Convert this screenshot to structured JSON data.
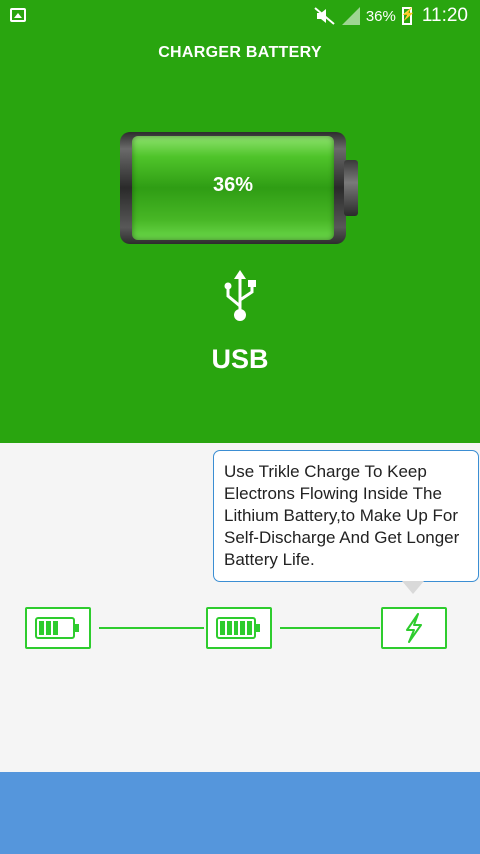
{
  "status_bar": {
    "battery_percent": "36%",
    "time": "11:20",
    "icons": [
      "gallery-notification-icon",
      "mute-icon",
      "signal-icon",
      "battery-charging-icon"
    ]
  },
  "header": {
    "title": "CHARGER BATTERY"
  },
  "battery": {
    "percent_text": "36%",
    "level": 0.36
  },
  "source": {
    "label": "USB",
    "icon": "usb-icon"
  },
  "tip": {
    "text": "Use Trikle Charge To Keep Electrons Flowing Inside The Lithium Battery,to Make Up For Self-Discharge And Get Longer Battery Life."
  },
  "stages": [
    {
      "name": "fast-charge",
      "icon": "battery-partial-icon",
      "cells": 3
    },
    {
      "name": "full-charge",
      "icon": "battery-full-icon",
      "cells": 5
    },
    {
      "name": "trickle-charge",
      "icon": "lightning-icon",
      "active": true
    }
  ],
  "colors": {
    "primary_green": "#29a50f",
    "stage_green": "#2ecc2e",
    "tip_border": "#3b8ed3",
    "bottom_bar": "#5596dc"
  }
}
